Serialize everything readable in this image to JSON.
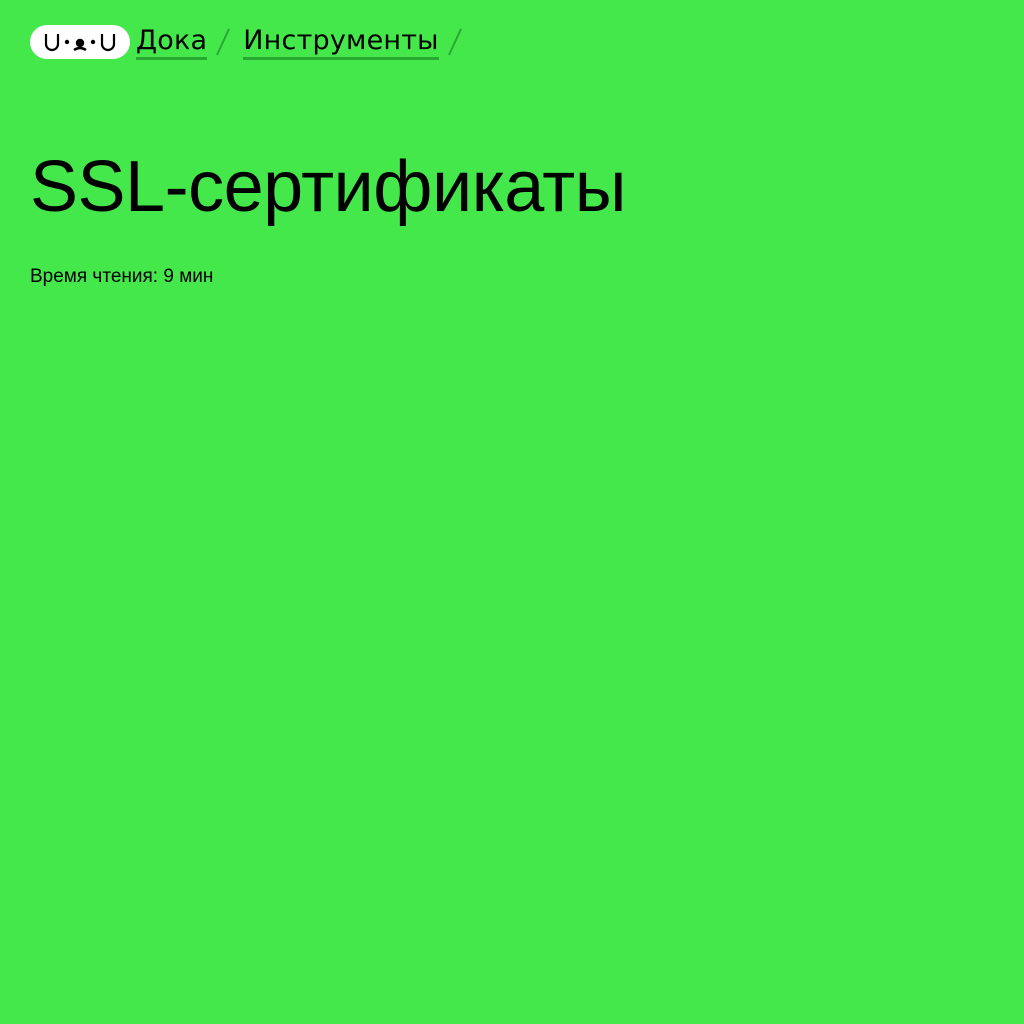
{
  "header": {
    "logo_label": "U·ᴥ·U",
    "breadcrumbs": [
      {
        "label": "Дока"
      },
      {
        "label": "Инструменты"
      }
    ]
  },
  "article": {
    "title": "SSL-сертификаты",
    "reading_time": "Время чтения: 9 мин"
  },
  "colors": {
    "background": "#44e84a",
    "underline": "#2aa834",
    "separator": "#2aa834"
  }
}
